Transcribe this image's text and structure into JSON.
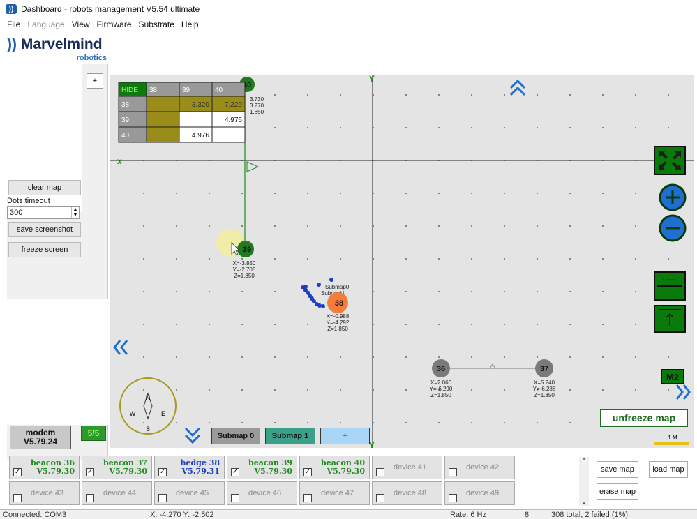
{
  "window": {
    "title": "Dashboard - robots management  V5.54  ultimate"
  },
  "menu": [
    "File",
    "Language",
    "View",
    "Firmware",
    "Substrate",
    "Help"
  ],
  "logo": {
    "brand": "Marvelmind",
    "sub": "robotics"
  },
  "left": {
    "axis_btn": "+",
    "clear_map": "clear map",
    "dots_timeout_label": "Dots timeout",
    "dots_timeout_value": "300",
    "save_screenshot": "save screenshot",
    "freeze_screen": "freeze screen"
  },
  "modem": {
    "label": "modem",
    "version": "V5.79.24",
    "count": "5/5"
  },
  "distance_table": {
    "header": [
      "HIDE",
      "38",
      "39",
      "40"
    ],
    "rows": [
      {
        "id": "38",
        "c38": "",
        "c39": "3.320",
        "c40": "7.220"
      },
      {
        "id": "39",
        "c38": "",
        "c39": "",
        "c40": "4.976"
      },
      {
        "id": "40",
        "c38": "",
        "c39": "4.976",
        "c40": ""
      }
    ]
  },
  "map": {
    "partial_readout": [
      "3.730",
      "3.270",
      "1.850"
    ],
    "hedge39": {
      "label": "39",
      "coords": [
        "X=-3.850",
        "Y=-2.705",
        "Z=1.850"
      ]
    },
    "hedge38": {
      "label": "38",
      "coords": [
        "X=-0.988",
        "Y=-4.292",
        "Z=1.850"
      ],
      "submaps": [
        "Submap0",
        "Submap1"
      ]
    },
    "beacon36": {
      "label": "36",
      "coords": [
        "X=2.060",
        "Y=-6.290",
        "Z=1.850"
      ]
    },
    "beacon37": {
      "label": "37",
      "coords": [
        "X=5.240",
        "Y=-6.288",
        "Z=1.850"
      ]
    },
    "compass": {
      "n": "N",
      "s": "S",
      "e": "E",
      "w": "W"
    },
    "m2": "M2",
    "scale": "1 M",
    "unfreeze": "unfreeze map",
    "submap0": "Submap 0",
    "submap1": "Submap 1",
    "add": "+"
  },
  "devices": [
    {
      "name": "beacon 36",
      "ver": "V5.79.30",
      "checked": true,
      "kind": "g"
    },
    {
      "name": "beacon 37",
      "ver": "V5.79.30",
      "checked": true,
      "kind": "g"
    },
    {
      "name": "hedge 38",
      "ver": "V5.79.31",
      "checked": true,
      "kind": "b"
    },
    {
      "name": "beacon 39",
      "ver": "V5.79.30",
      "checked": true,
      "kind": "g"
    },
    {
      "name": "beacon 40",
      "ver": "V5.79.30",
      "checked": true,
      "kind": "g"
    },
    {
      "name": "device 41",
      "checked": false
    },
    {
      "name": "device 42",
      "checked": false
    },
    {
      "name": "device 43",
      "checked": false
    },
    {
      "name": "device 44",
      "checked": false
    },
    {
      "name": "device 45",
      "checked": false
    },
    {
      "name": "device 46",
      "checked": false
    },
    {
      "name": "device 47",
      "checked": false
    },
    {
      "name": "device 48",
      "checked": false
    },
    {
      "name": "device 49",
      "checked": false
    }
  ],
  "actions": {
    "save_map": "save map",
    "load_map": "load map",
    "erase_map": "erase map"
  },
  "status": {
    "connection": "Connected: COM3",
    "cursor": "X: -4.270  Y: -2.502",
    "rate": "Rate: 6 Hz",
    "n": "8",
    "summary": "308 total, 2 failed (1%)"
  },
  "colors": {
    "green": "#1f8a1f",
    "dark_green": "#0a5a0a",
    "orange": "#f57c3a",
    "blue": "#1a3fc0",
    "grey": "#7a7a7a"
  }
}
